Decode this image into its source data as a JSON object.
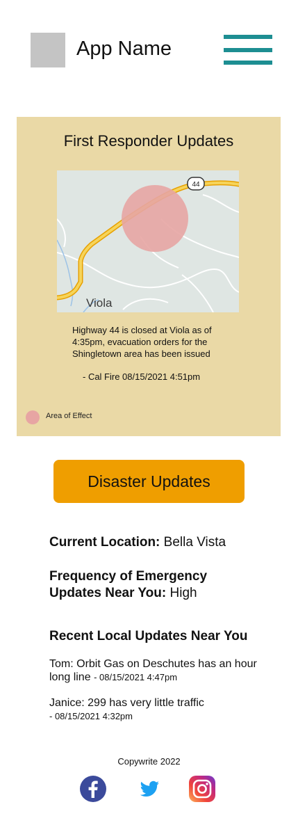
{
  "header": {
    "app_name": "App Name",
    "menu_icon": "hamburger-icon",
    "menu_color": "#1d8e92"
  },
  "responder_card": {
    "title": "First Responder Updates",
    "map": {
      "route_shield": "44",
      "place_label": "Viola",
      "area_color": "#e7a5a3"
    },
    "message": "Highway 44 is closed at Viola as of 4:35pm, evacuation orders for the Shingletown area has been issued",
    "source": "- Cal Fire 08/15/2021 4:51pm",
    "legend_label": "Area of Effect",
    "background": "#ead9a6"
  },
  "disaster_button": {
    "label": "Disaster Updates",
    "color": "#ef9e00"
  },
  "current_location": {
    "label": "Current Location:",
    "value": "Bella Vista"
  },
  "frequency": {
    "label_line1": "Frequency of Emergency",
    "label_line2": "Updates  Near You:",
    "value": "High"
  },
  "recent": {
    "heading": "Recent Local Updates Near You",
    "items": [
      {
        "text_line1": "Tom: Orbit Gas on Deschutes has an hour",
        "text_line2": "long line",
        "timestamp": " - 08/15/2021 4:47pm"
      },
      {
        "text_line1": "Janice: 299 has very little traffic",
        "timestamp": " - 08/15/2021 4:32pm"
      }
    ]
  },
  "footer": {
    "copyright": "Copywrite 2022",
    "social_icons": [
      "facebook-icon",
      "twitter-icon",
      "instagram-icon"
    ]
  }
}
